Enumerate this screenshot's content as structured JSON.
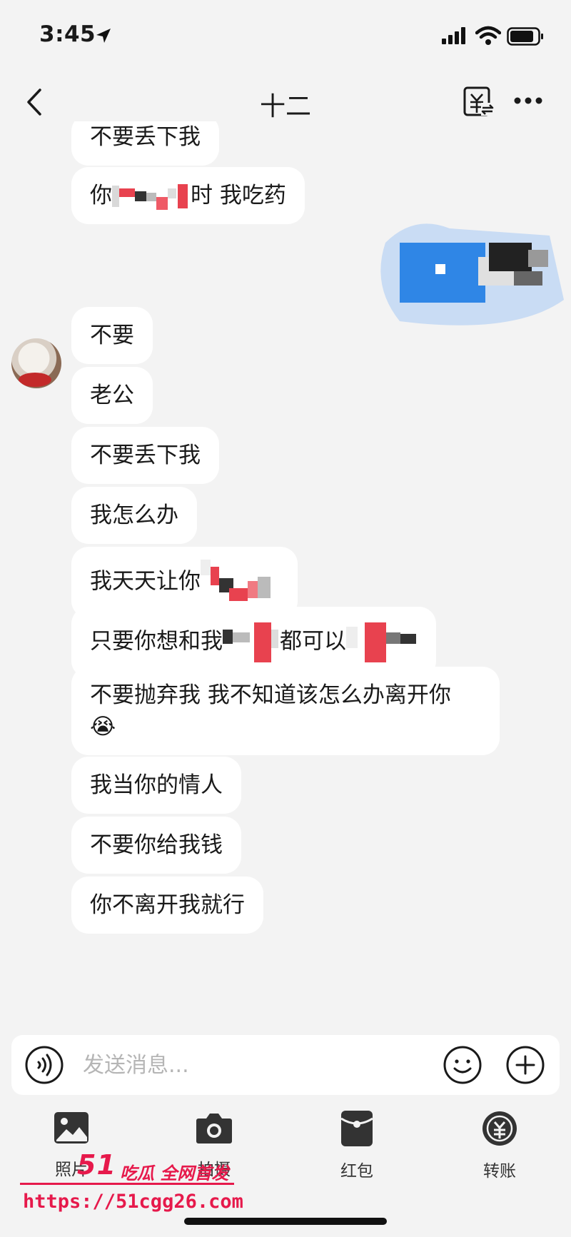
{
  "status_bar": {
    "time": "3:45"
  },
  "header": {
    "title": "十二"
  },
  "messages": [
    {
      "text": "不要丢下我"
    },
    {
      "text_before": "你",
      "text_mid": "时",
      "text_after": " 我吃药"
    },
    {
      "text": "不要"
    },
    {
      "text": "老公"
    },
    {
      "text": "不要丢下我"
    },
    {
      "text": "我怎么办"
    },
    {
      "text_before": "我天天让你"
    },
    {
      "text_before": "只要你想和我",
      "text_mid": "都可以",
      "text_after": ""
    },
    {
      "text": "不要抛弃我 我不知道该怎么办离开你",
      "emoji": "😭"
    },
    {
      "text": "我当你的情人"
    },
    {
      "text": "不要你给我钱"
    },
    {
      "text": "你不离开我就行"
    }
  ],
  "input": {
    "placeholder": "发送消息..."
  },
  "toolbar": {
    "photo_label": "照片",
    "camera_label": "拍摄",
    "redpacket_label": "红包",
    "transfer_label": "转账"
  },
  "watermark": {
    "brand": "51",
    "tag": "吃瓜 全网首发",
    "url": "https://51cgg26.com"
  },
  "colors": {
    "background": "#f3f3f3",
    "bubble": "#ffffff",
    "watermark": "#e6194b"
  }
}
